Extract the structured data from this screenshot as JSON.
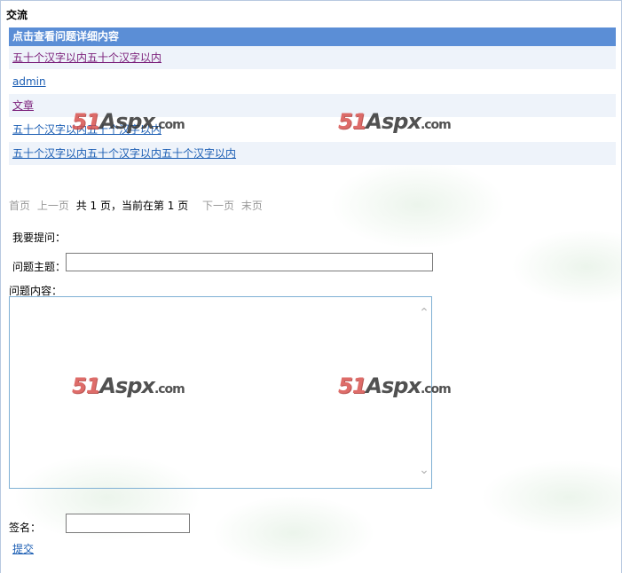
{
  "page_title": "交流",
  "list": {
    "header": "点击查看问题详细内容",
    "items": [
      {
        "text": "五十个汉字以内五十个汉字以内",
        "visited": true
      },
      {
        "text": "admin",
        "visited": false
      },
      {
        "text": "文章",
        "visited": true
      },
      {
        "text": "五十个汉字以内五十个汉字以内",
        "visited": false
      },
      {
        "text": "五十个汉字以内五十个汉字以内五十个汉字以内",
        "visited": false
      }
    ]
  },
  "pager": {
    "first": "首页",
    "prev": "上一页",
    "info": "共 1 页，当前在第 1 页",
    "next": "下一页",
    "last": "末页"
  },
  "form": {
    "ask_label": "我要提问：",
    "subject_label": "问题主题：",
    "subject_value": "",
    "content_label": "问题内容：",
    "content_value": "",
    "signature_label": "签名：",
    "signature_value": "",
    "submit_label": "提交"
  },
  "watermark": {
    "number": "51",
    "brand": "Aspx",
    "domain": ".com"
  },
  "colors": {
    "header_bg": "#5b8ed6",
    "row_alt_bg": "#eef3fa",
    "link": "#1a5db3",
    "link_visited": "#7a1f7a"
  }
}
